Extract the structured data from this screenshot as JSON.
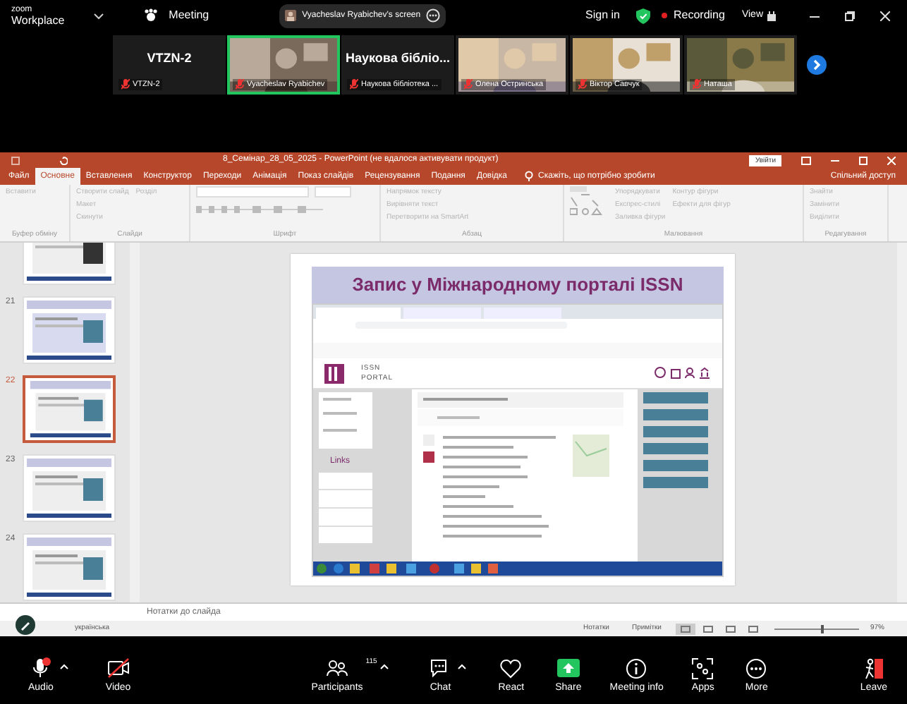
{
  "zoom_header": {
    "brand_small": "zoom",
    "brand": "Workplace",
    "meeting": "Meeting",
    "share_label": "Vyacheslav Ryabichev's screen",
    "sign_in": "Sign in",
    "recording": "Recording",
    "view": "View"
  },
  "participants": [
    {
      "kind": "name",
      "display": "VTZN-2",
      "name": "VTZN-2",
      "selected": false
    },
    {
      "kind": "picture",
      "name": "Vyacheslav Ryabichev",
      "selected": true
    },
    {
      "kind": "name",
      "display": "Наукова  бібліо...",
      "name": "Наукова бібліотека ...",
      "selected": false
    },
    {
      "kind": "picture",
      "name": "Олена Остринська",
      "selected": false
    },
    {
      "kind": "picture",
      "name": "Віктор Савчук",
      "selected": false
    },
    {
      "kind": "picture",
      "name": "Наташа",
      "selected": false
    }
  ],
  "ppt": {
    "title": "8_Семінар_28_05_2025  -  PowerPoint (не вдалося активувати продукт)",
    "sign_in": "Увійти",
    "tabs": [
      {
        "label": "Файл",
        "selected": false
      },
      {
        "label": "Основне",
        "selected": true
      },
      {
        "label": "Вставлення",
        "selected": false
      },
      {
        "label": "Конструктор",
        "selected": false
      },
      {
        "label": "Переходи",
        "selected": false
      },
      {
        "label": "Анімація",
        "selected": false
      },
      {
        "label": "Показ слайдів",
        "selected": false
      },
      {
        "label": "Рецензування",
        "selected": false
      },
      {
        "label": "Подання",
        "selected": false
      },
      {
        "label": "Довідка",
        "selected": false
      }
    ],
    "tell_me": "Скажіть, що потрібно зробити",
    "share": "Спільний доступ",
    "ribbon_groups": [
      {
        "label": "Буфер обміну",
        "items": [
          "Вставити"
        ]
      },
      {
        "label": "Слайди",
        "items": [
          "Створити слайд",
          "Макет",
          "Скинути",
          "Розділ"
        ]
      },
      {
        "label": "Шрифт"
      },
      {
        "label": "Абзац",
        "items": [
          "Напрямок тексту",
          "Вирівняти текст",
          "Перетворити на SmartArt"
        ]
      },
      {
        "label": "Малювання",
        "items": [
          "Упорядкувати",
          "Експрес-стилі",
          "Заливка фігури",
          "Контур фігури",
          "Ефекти для фігур"
        ]
      },
      {
        "label": "Редагування",
        "items": [
          "Знайти",
          "Замінити",
          "Виділити"
        ]
      }
    ]
  },
  "thumbnails": [
    {
      "selected": false
    },
    {
      "number": "21",
      "selected": false
    },
    {
      "number": "22",
      "selected": true
    },
    {
      "number": "23",
      "selected": false
    },
    {
      "number": "24",
      "selected": false
    }
  ],
  "slide": {
    "title": "Запис у Міжнародному порталі ISSN",
    "portal_logo": "ISSN PORTAL",
    "links_heading": "Links"
  },
  "notes_placeholder": "Нотатки до слайда",
  "status_bar": {
    "language": "українська",
    "notes": "Нотатки",
    "comments": "Примітки",
    "zoom": "97%"
  },
  "toolbar": [
    {
      "kind": "audio",
      "label": "Audio"
    },
    {
      "kind": "video",
      "label": "Video"
    },
    {
      "kind": "participants",
      "label": "Participants",
      "count": "115"
    },
    {
      "kind": "chat",
      "label": "Chat"
    },
    {
      "kind": "react",
      "label": "React"
    },
    {
      "kind": "share",
      "label": "Share"
    },
    {
      "kind": "info",
      "label": "Meeting info"
    },
    {
      "kind": "apps",
      "label": "Apps"
    },
    {
      "kind": "more",
      "label": "More"
    },
    {
      "kind": "leave",
      "label": "Leave"
    }
  ]
}
